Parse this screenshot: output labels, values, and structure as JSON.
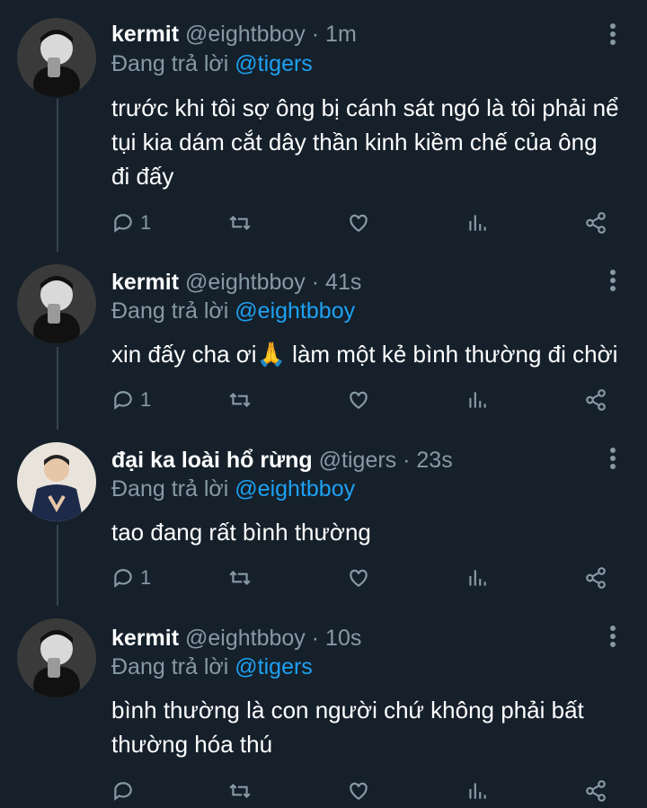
{
  "colors": {
    "background": "#15202b",
    "muted": "#8899a6",
    "accent": "#1da1f2",
    "thread_line": "#38444d"
  },
  "replying_label": "Đang trả lời",
  "tweets": [
    {
      "name": "kermit",
      "handle": "@eightbboy",
      "separator": "·",
      "time": "1m",
      "reply_to": "@tigers",
      "text_lines": [
        "trước khi tôi sợ ông bị cánh sát ngó là tôi phải nể",
        "tụi kia dám cắt dây thần kinh kiềm chế của ông",
        "đi đấy"
      ],
      "reply_count": "1",
      "avatar": "man-drinking-avatar"
    },
    {
      "name": "kermit",
      "handle": "@eightbboy",
      "separator": "·",
      "time": "41s",
      "reply_to": "@eightbboy",
      "text_lines": [
        "xin đấy cha ơi🙏 làm một kẻ bình thường đi chời"
      ],
      "reply_count": "1",
      "avatar": "man-drinking-avatar"
    },
    {
      "name": "đại ka loài hổ rừng",
      "handle": "@tigers",
      "separator": "·",
      "time": "23s",
      "reply_to": "@eightbboy",
      "text_lines": [
        "tao đang rất bình thường"
      ],
      "reply_count": "1",
      "avatar": "man-suit-avatar"
    },
    {
      "name": "kermit",
      "handle": "@eightbboy",
      "separator": "·",
      "time": "10s",
      "reply_to": "@tigers",
      "text_lines": [
        "bình thường là con người chứ không phải bất",
        "thường hóa thú"
      ],
      "reply_count": "",
      "avatar": "man-drinking-avatar"
    }
  ],
  "icons": {
    "reply": "reply-icon",
    "retweet": "retweet-icon",
    "like": "heart-icon",
    "stats": "stats-icon",
    "share": "share-icon",
    "menu": "more-vertical-icon"
  }
}
